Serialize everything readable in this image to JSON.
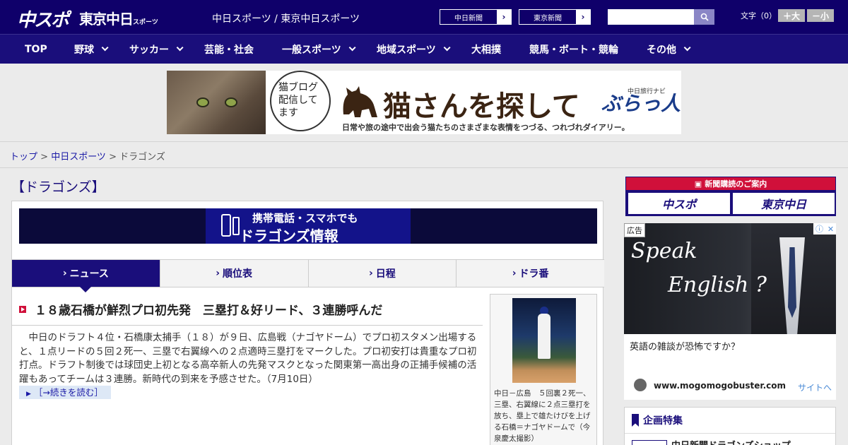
{
  "header": {
    "logo_main": "中スポ",
    "logo_tokyo": "東京中日",
    "logo_tokyo_suffix": "スポーツ",
    "site_name": "中日スポーツ / 東京中日スポーツ",
    "paper_buttons": [
      "中日新聞",
      "東京新聞"
    ],
    "search_placeholder": "",
    "font_label": "文字（0）",
    "font_larger": "＋大",
    "font_smaller": "－小"
  },
  "nav": {
    "items": [
      {
        "label": "TOP",
        "dropdown": false
      },
      {
        "label": "野球",
        "dropdown": true
      },
      {
        "label": "サッカー",
        "dropdown": true
      },
      {
        "label": "芸能・社会",
        "dropdown": false
      },
      {
        "label": "一般スポーツ",
        "dropdown": true
      },
      {
        "label": "地域スポーツ",
        "dropdown": true
      },
      {
        "label": "大相撲",
        "dropdown": false
      },
      {
        "label": "競馬・ボート・競輪",
        "dropdown": false
      },
      {
        "label": "その他",
        "dropdown": true
      }
    ]
  },
  "banner": {
    "bubble_text": "猫ブログ配信してます",
    "title": "猫さんを探して",
    "subtitle": "日常や旅の途中で出会う猫たちのさまざまな表情をつづる、つれづれダイアリー。",
    "brand_small": "中日旅行ナビ",
    "brand": "ぶらっ人"
  },
  "breadcrumb": {
    "top": "トップ",
    "section": "中日スポーツ",
    "current": "ドラゴンズ",
    "sep": " > "
  },
  "page": {
    "title": "【ドラゴンズ】"
  },
  "mobile_banner": {
    "line1": "携帯電話・スマホでも",
    "line2": "ドラゴンズ情報"
  },
  "tabs": [
    {
      "label": "ニュース",
      "active": true
    },
    {
      "label": "順位表",
      "active": false
    },
    {
      "label": "日程",
      "active": false
    },
    {
      "label": "ドラ番",
      "active": false
    }
  ],
  "article": {
    "headline": "１８歳石橋が鮮烈プロ初先発　三塁打＆好リード、３連勝呼んだ",
    "body": "中日のドラフト４位・石橋康太捕手（１８）が９日、広島戦（ナゴヤドーム）でプロ初スタメン出場すると、１点リードの５回２死一、三塁で右翼線への２点適時三塁打をマークした。プロ初安打は貴重なプロ初打点。ドラフト制後では球団史上初となる高卒新人の先発マスクとなった関東第一高出身の正捕手候補の活躍もあってチームは３連勝。新時代の到来を予感させた。（7月10日）",
    "read_more": "［→続きを読む］",
    "photo_caption": "中日－広島　５回裏２死一、三塁、右翼線に２点三塁打を放ち、塁上で雄たけびを上げる石橋＝ナゴヤドームで（今泉慶太撮影）"
  },
  "sidebar": {
    "subscribe_head": "新聞購読のご案内",
    "subscribe_buttons": [
      "中スポ",
      "東京中日"
    ],
    "ad_label": "広告",
    "ad_script1": "Speak",
    "ad_script2": "English ?",
    "ad_question": "英語の雑談が恐怖ですか？",
    "ad_url": "www.mogomogobuster.com",
    "ad_visit": "サイトへ",
    "feature_head": "企画特集",
    "feature_item": "中日新聞ドラゴンズショップ"
  },
  "colors": {
    "brand_navy": "#0f006a",
    "accent_red": "#d0103a"
  }
}
